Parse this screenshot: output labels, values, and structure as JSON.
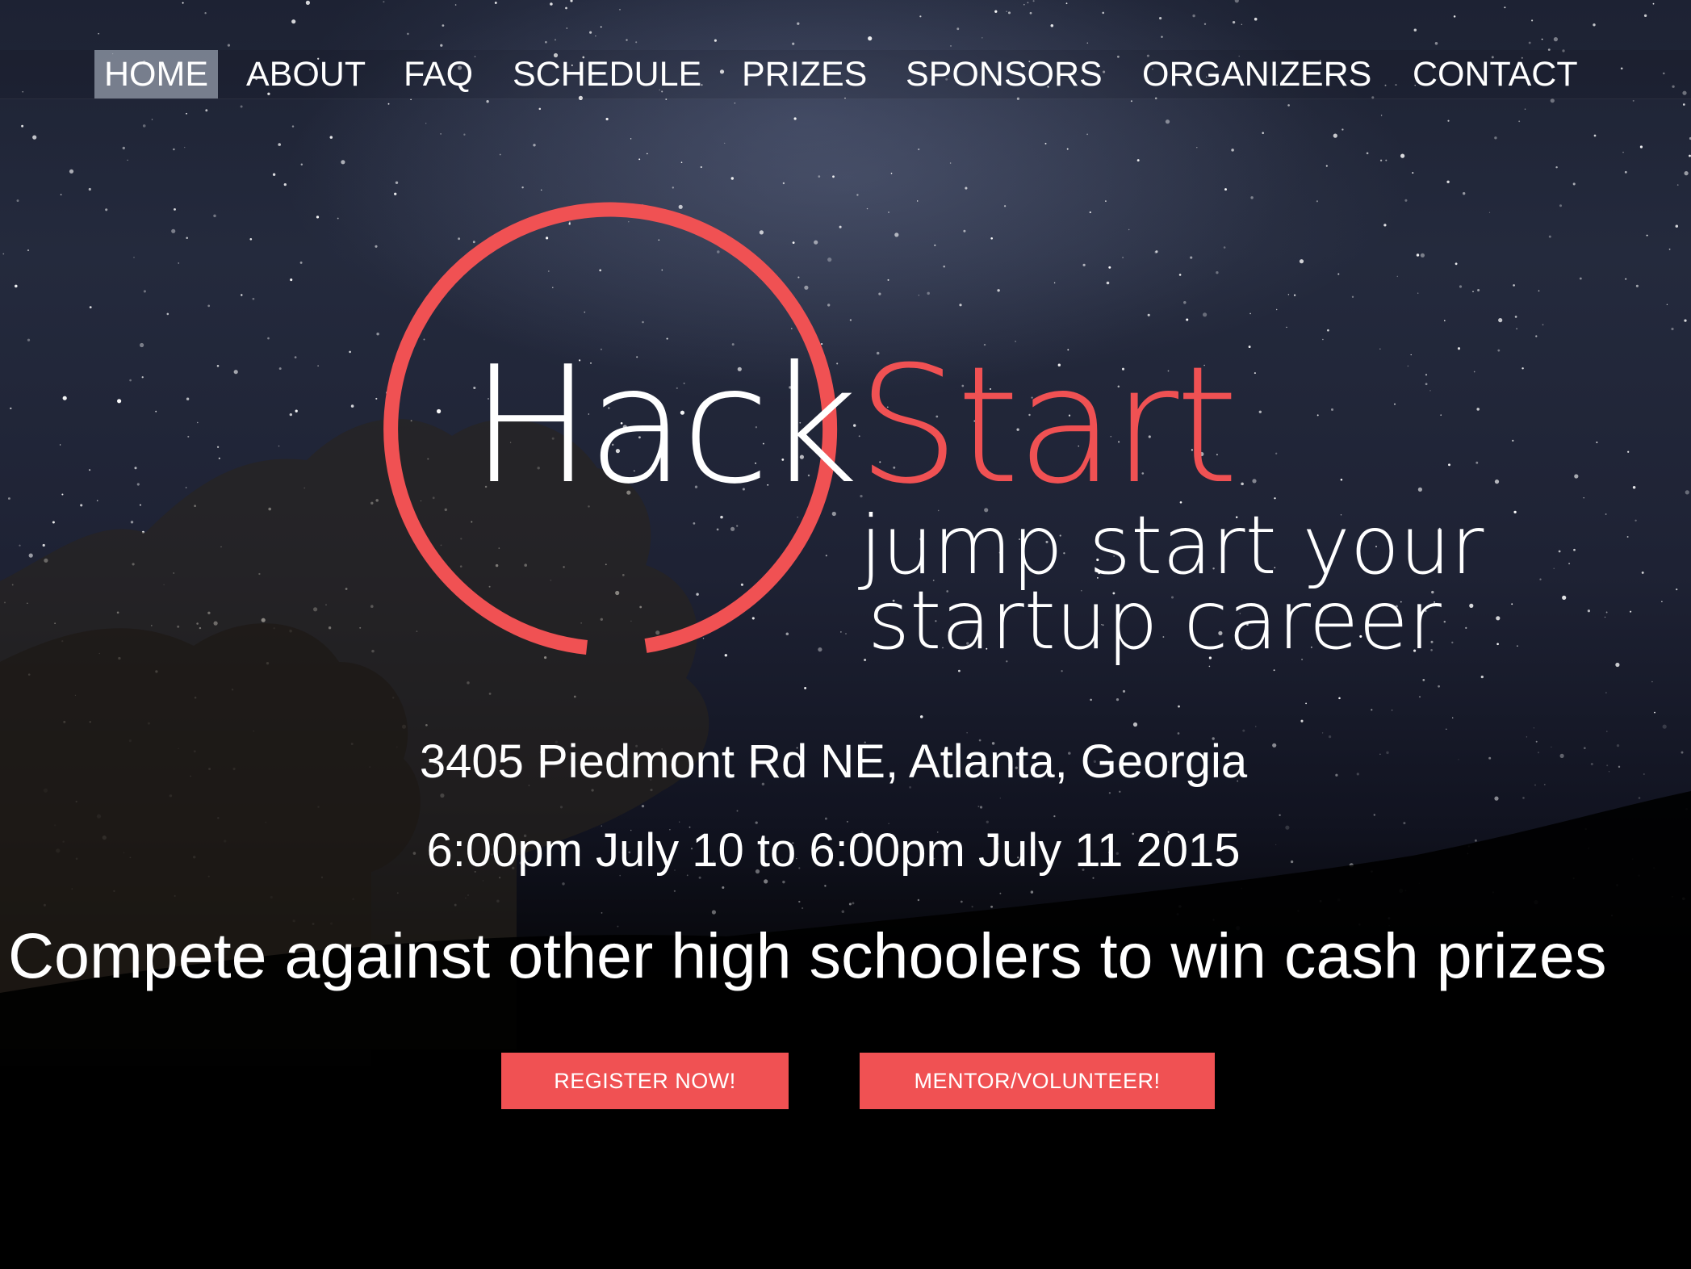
{
  "nav": {
    "items": [
      {
        "label": "HOME",
        "active": true
      },
      {
        "label": "ABOUT"
      },
      {
        "label": "FAQ"
      },
      {
        "label": "SCHEDULE"
      },
      {
        "label": "PRIZES"
      },
      {
        "label": "SPONSORS"
      },
      {
        "label": "ORGANIZERS"
      },
      {
        "label": "CONTACT"
      }
    ]
  },
  "logo": {
    "word_white": "Hack",
    "word_accent": "Start",
    "tagline_line1": "jump start your",
    "tagline_line2": "startup career"
  },
  "event": {
    "address": "3405 Piedmont Rd NE, Atlanta, Georgia",
    "dates": "6:00pm July 10 to 6:00pm July 11 2015",
    "pitch": "Compete against other high schoolers to win cash prizes"
  },
  "buttons": {
    "register": "REGISTER NOW!",
    "mentor": "MENTOR/VOLUNTEER!"
  },
  "colors": {
    "accent": "#f05153",
    "text": "#ffffff",
    "nav_active_bg": "#969eac"
  }
}
